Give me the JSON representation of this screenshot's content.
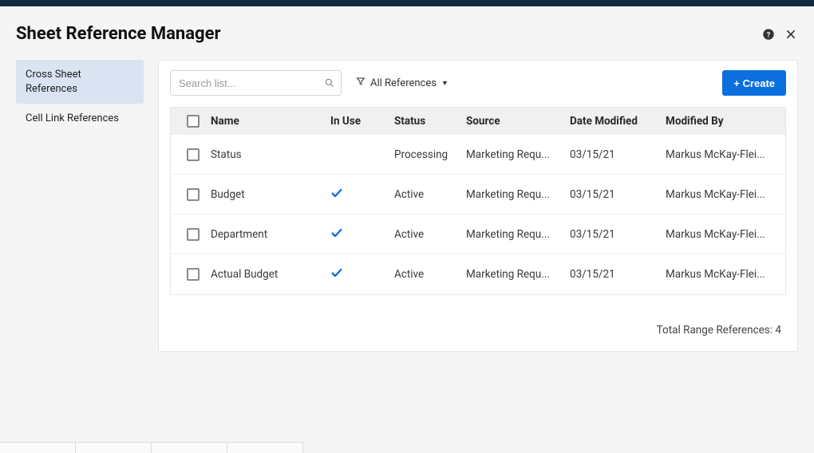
{
  "dialog": {
    "title": "Sheet Reference Manager"
  },
  "sidebar": {
    "items": [
      {
        "label": "Cross Sheet References",
        "active": true
      },
      {
        "label": "Cell Link References",
        "active": false
      }
    ]
  },
  "toolbar": {
    "search_placeholder": "Search list...",
    "filter_label": "All References",
    "create_label": "+ Create"
  },
  "table": {
    "columns": {
      "name": "Name",
      "in_use": "In Use",
      "status": "Status",
      "source": "Source",
      "date_modified": "Date Modified",
      "modified_by": "Modified By"
    },
    "rows": [
      {
        "name": "Status",
        "in_use": false,
        "status": "Processing",
        "source": "Marketing Requ...",
        "date_modified": "03/15/21",
        "modified_by": "Markus McKay-Flei..."
      },
      {
        "name": "Budget",
        "in_use": true,
        "status": "Active",
        "source": "Marketing Requ...",
        "date_modified": "03/15/21",
        "modified_by": "Markus McKay-Flei..."
      },
      {
        "name": "Department",
        "in_use": true,
        "status": "Active",
        "source": "Marketing Requ...",
        "date_modified": "03/15/21",
        "modified_by": "Markus McKay-Flei..."
      },
      {
        "name": "Actual Budget",
        "in_use": true,
        "status": "Active",
        "source": "Marketing Requ...",
        "date_modified": "03/15/21",
        "modified_by": "Markus McKay-Flei..."
      }
    ]
  },
  "footer": {
    "total_label": "Total Range References:",
    "total_count": "4"
  }
}
